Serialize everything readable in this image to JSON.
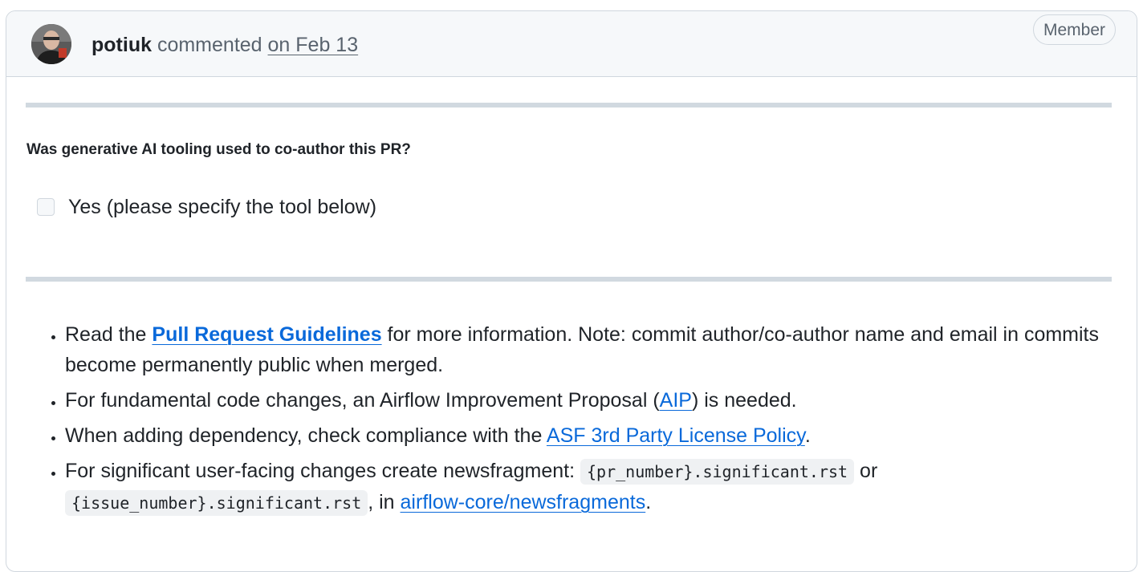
{
  "comment": {
    "author": "potiuk",
    "action": "commented",
    "timestamp": "on Feb 13",
    "badge": "Member",
    "avatar_icon": "user-avatar-photo"
  },
  "body": {
    "question": "Was generative AI tooling used to co-author this PR?",
    "checkbox": {
      "label": "Yes (please specify the tool below)",
      "checked": false
    },
    "bullets": [
      {
        "pre": "Read the ",
        "link": "Pull Request Guidelines",
        "post": " for more information. Note: commit author/co-author name and email in commits become permanently public when merged."
      },
      {
        "pre": "For fundamental code changes, an Airflow Improvement Proposal (",
        "link": "AIP",
        "post": ") is needed."
      },
      {
        "pre": "When adding dependency, check compliance with the ",
        "link": "ASF 3rd Party License Policy",
        "post": "."
      },
      {
        "pre": "For significant user-facing changes create newsfragment: ",
        "code1": "{pr_number}.significant.rst",
        "mid": " or ",
        "code2": "{issue_number}.significant.rst",
        "mid2": ", in ",
        "link": "airflow-core/newsfragments",
        "post": "."
      }
    ]
  },
  "colors": {
    "link": "#0969da",
    "text": "#1f2328",
    "muted": "#59636e",
    "border": "#d0d7de",
    "header_bg": "#f6f8fa",
    "rule": "#d1d9e0"
  }
}
